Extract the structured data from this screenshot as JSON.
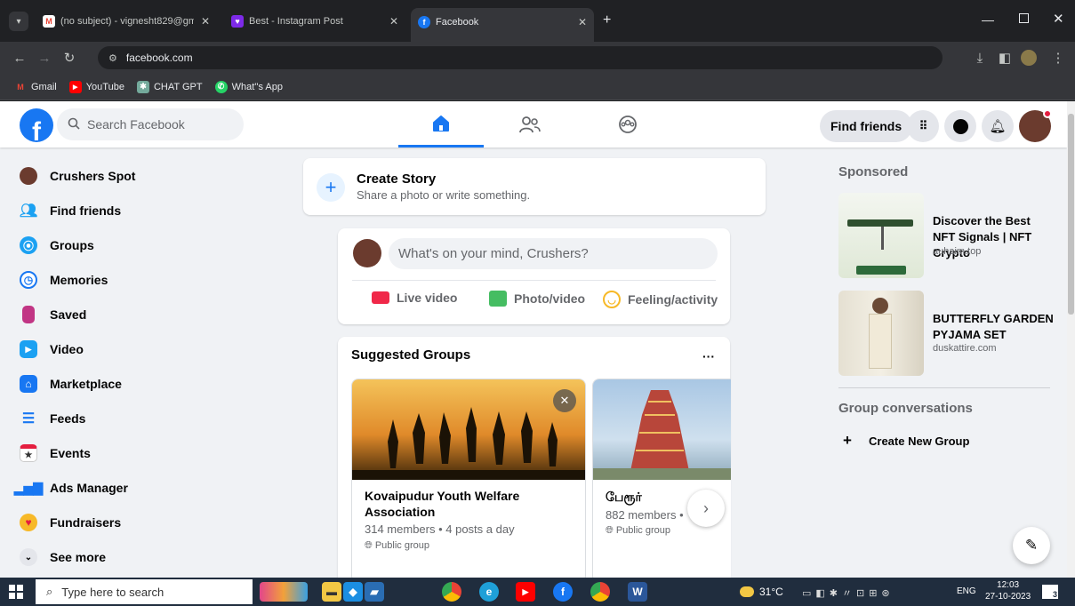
{
  "browser": {
    "tabs": [
      {
        "label": "(no subject) - vignesht829@gm"
      },
      {
        "label": "Best - Instagram Post"
      },
      {
        "label": "Facebook"
      }
    ],
    "url": "facebook.com",
    "bookmarks": [
      {
        "label": "Gmail"
      },
      {
        "label": "YouTube"
      },
      {
        "label": "CHAT GPT"
      },
      {
        "label": "What''s App"
      }
    ]
  },
  "header": {
    "search_placeholder": "Search Facebook",
    "find_friends": "Find friends"
  },
  "sidebar": {
    "items": [
      {
        "label": "Crushers Spot",
        "icon": "profile-avatar"
      },
      {
        "label": "Find friends",
        "icon": "friends-icon"
      },
      {
        "label": "Groups",
        "icon": "groups-icon"
      },
      {
        "label": "Memories",
        "icon": "clock-icon"
      },
      {
        "label": "Saved",
        "icon": "bookmark-icon"
      },
      {
        "label": "Video",
        "icon": "play-icon"
      },
      {
        "label": "Marketplace",
        "icon": "shop-icon"
      },
      {
        "label": "Feeds",
        "icon": "feeds-icon"
      },
      {
        "label": "Events",
        "icon": "calendar-icon"
      },
      {
        "label": "Ads Manager",
        "icon": "chart-icon"
      },
      {
        "label": "Fundraisers",
        "icon": "heart-icon"
      },
      {
        "label": "See more",
        "icon": "chevron-down-icon"
      }
    ]
  },
  "story": {
    "title": "Create Story",
    "subtitle": "Share a photo or write something."
  },
  "composer": {
    "placeholder": "What's on your mind, Crushers?",
    "actions": [
      {
        "label": "Live video"
      },
      {
        "label": "Photo/video"
      },
      {
        "label": "Feeling/activity"
      }
    ]
  },
  "suggested": {
    "title": "Suggested Groups",
    "more": "···",
    "groups": [
      {
        "name": "Kovaipudur Youth Welfare Association",
        "meta": "314 members • 4 posts a day",
        "privacy": "Public group"
      },
      {
        "name": "பேரூர்",
        "meta": "882 members •",
        "privacy": "Public group"
      }
    ]
  },
  "right": {
    "sponsored": "Sponsored",
    "ads": [
      {
        "title": "Discover the Best NFT Signals | NFT Crypto",
        "domain": "auhaim.top"
      },
      {
        "title": "BUTTERFLY GARDEN PYJAMA SET",
        "domain": "duskattire.com"
      }
    ],
    "group_conversations": "Group conversations",
    "create_group": "Create New Group"
  },
  "taskbar": {
    "search": "Type here to search",
    "temp": "31°C",
    "lang": "ENG",
    "time": "12:03",
    "date": "27-10-2023",
    "notif": "3"
  },
  "colors": {
    "fb_blue": "#1877f2",
    "fb_bg": "#f0f2f5",
    "chrome_dark": "#202124"
  }
}
